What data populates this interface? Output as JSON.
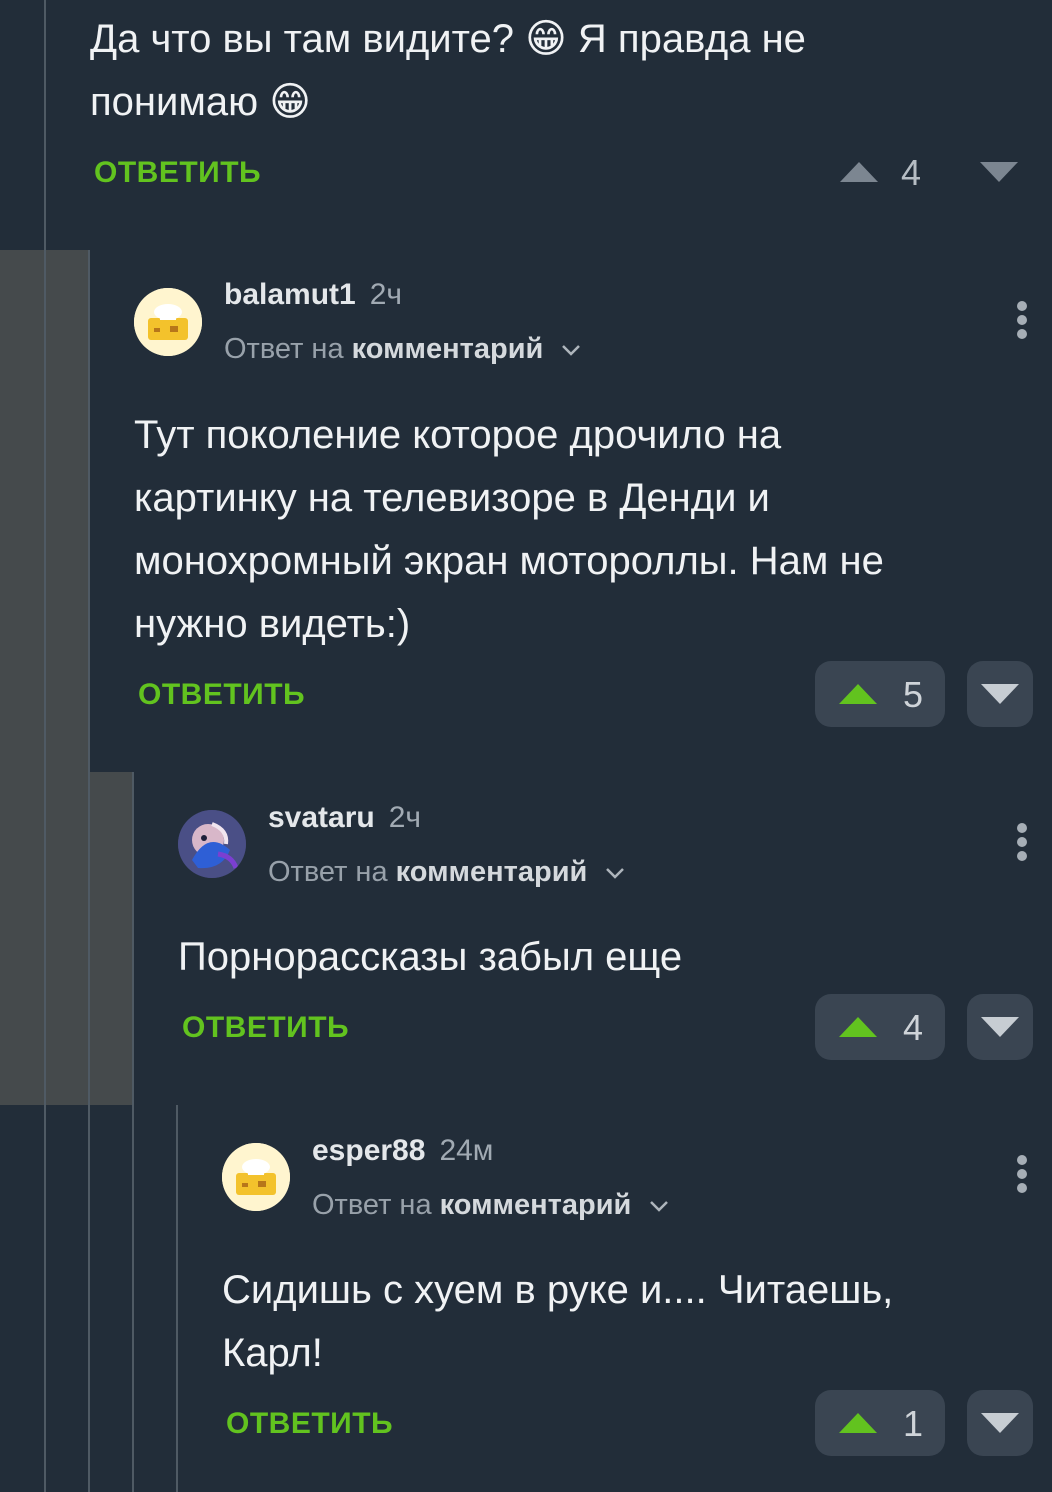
{
  "top_comment": {
    "text_line1": "Да что вы там видите? 😁 Я правда не",
    "text_line2": "понимаю 😁",
    "reply_label": "ОТВЕТИТЬ",
    "rating": "4"
  },
  "comments": [
    {
      "username": "balamut1",
      "time": "2ч",
      "reply_prefix": "Ответ на",
      "reply_target": "комментарий",
      "text": [
        "Тут поколение которое дрочило на",
        "картинку на телевизоре в Денди и",
        "монохромный экран мотороллы. Нам не",
        "нужно видеть:)"
      ],
      "reply_label": "ОТВЕТИТЬ",
      "rating": "5"
    },
    {
      "username": "svataru",
      "time": "2ч",
      "reply_prefix": "Ответ на",
      "reply_target": "комментарий",
      "text": [
        "Порнорассказы забыл еще"
      ],
      "reply_label": "ОТВЕТИТЬ",
      "rating": "4"
    },
    {
      "username": "esper88",
      "time": "24м",
      "reply_prefix": "Ответ на",
      "reply_target": "комментарий",
      "text": [
        "Сидишь с хуем в руке и.... Читаешь,",
        "Карл!"
      ],
      "reply_label": "ОТВЕТИТЬ",
      "rating": "1"
    }
  ],
  "colors": {
    "background": "#222d39",
    "reply_green": "#62c31f",
    "upvote_green": "#62c31f",
    "highlight_band": "#454a4c",
    "pill": "#3a4552"
  },
  "icons": [
    "grinning-emoji-icon",
    "upvote-icon",
    "downvote-icon",
    "more-icon",
    "chevron-down-icon",
    "chef-hat-avatar-icon"
  ]
}
